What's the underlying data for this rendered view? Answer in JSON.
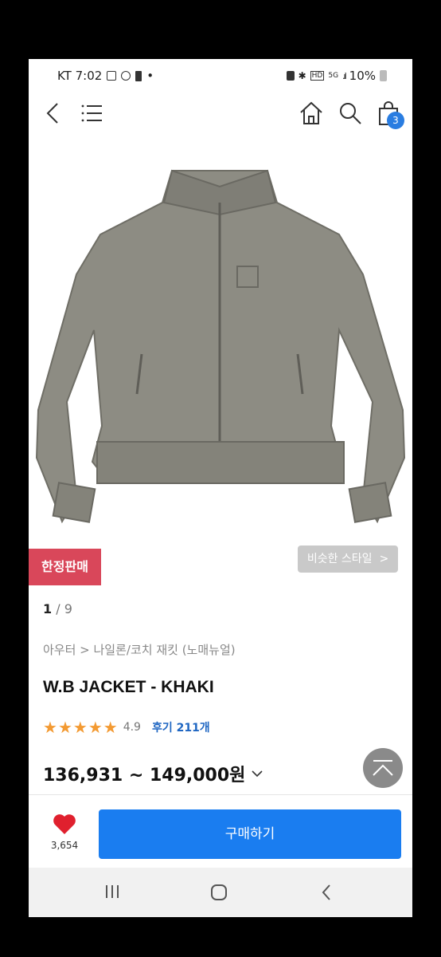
{
  "status_bar": {
    "carrier_time": "KT 7:02",
    "battery": "10%",
    "network": "5G"
  },
  "nav": {
    "cart_count": "3"
  },
  "product": {
    "limited_badge": "한정판매",
    "similar_style": "비슷한 스타일",
    "pager": {
      "current": "1",
      "total": "9"
    },
    "breadcrumb": "아우터 > 나일론/코치 재킷 (노매뉴얼)",
    "title": "W.B JACKET - KHAKI",
    "rating": "4.9",
    "reviews": "후기 211개",
    "price": "136,931 ~ 149,000원"
  },
  "action_bar": {
    "like_count": "3,654",
    "buy_label": "구매하기"
  },
  "colors": {
    "badge": "#d9475a",
    "buy_button": "#1a7df0",
    "star": "#f39a32",
    "reviews_link": "#1f66c2"
  }
}
